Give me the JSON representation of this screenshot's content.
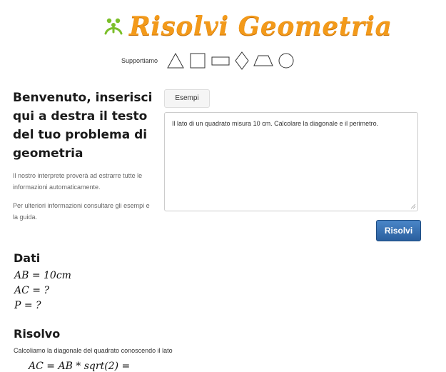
{
  "header": {
    "title": "Risolvi Geometria",
    "logo_icon": "frog-icon",
    "brand_color": "#f39a1a"
  },
  "supported": {
    "label": "Supportiamo",
    "shapes": [
      "triangle-icon",
      "square-icon",
      "rectangle-icon",
      "rhombus-icon",
      "trapezoid-icon",
      "circle-icon"
    ]
  },
  "intro": {
    "heading": "Benvenuto, inserisci qui a destra il testo del tuo problema di geometria",
    "paragraph1": "Il nostro interprete proverà ad estrarre tutte le informazioni automaticamente.",
    "paragraph2": "Per ulteriori informazioni consultare gli esempi e la guida."
  },
  "form": {
    "examples_label": "Esempi",
    "problem_text": "Il lato di un quadrato misura 10 cm. Calcolare la diagonale e il perimetro.",
    "solve_label": "Risolvi",
    "solve_color": "#2a5f9e"
  },
  "data_section": {
    "title": "Dati",
    "lines": [
      "AB = 10cm",
      "AC = ?",
      "P = ?"
    ]
  },
  "solve_section": {
    "title": "Risolvo",
    "step_text": "Calcoliamo la diagonale del quadrato conoscendo il lato",
    "formula": "AC = AB * sqrt(2) ="
  }
}
